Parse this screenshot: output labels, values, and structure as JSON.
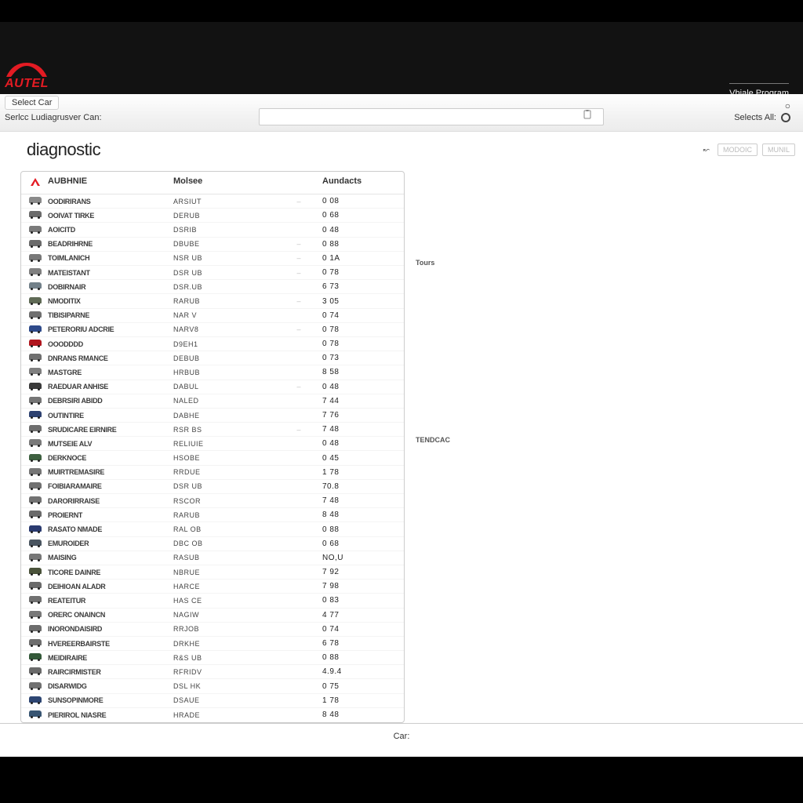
{
  "brand": {
    "name": "AUTEL"
  },
  "header": {
    "program_link": "Vhiale Program"
  },
  "filters": {
    "select_car": "Select Car",
    "serial_label": "Serlcc Ludiagrusver Can:",
    "search_placeholder": "",
    "select_all": "Selects All:"
  },
  "page": {
    "title": "diagnostic"
  },
  "action_buttons": {
    "a": "MODOIC",
    "b": "MUNIL"
  },
  "side_labels": {
    "tours": "Tours",
    "tender": "TENDCAC"
  },
  "table": {
    "head_brand": "AUBHNIE",
    "head_model": "Molsee",
    "head_amount": "Aundacts",
    "brand_icon_color": "#e31b23",
    "rows": [
      {
        "color": "#8a8a8a",
        "name": "OODIRIRANS",
        "model": "ARSIUT",
        "mid": "–",
        "amount": "0 08"
      },
      {
        "color": "#6b6b6b",
        "name": "OOIVAT TIRKE",
        "model": "DERUB",
        "mid": "",
        "amount": "0 68"
      },
      {
        "color": "#7a7a7a",
        "name": "AOICITD",
        "model": "DSRIB",
        "mid": "",
        "amount": "0 48"
      },
      {
        "color": "#6a6a6a",
        "name": "BEADRIHRNE",
        "model": "DBUBE",
        "mid": "–",
        "amount": "0 88"
      },
      {
        "color": "#787878",
        "name": "TOIMLANICH",
        "model": "NSR UB",
        "mid": "–",
        "amount": "0 1A"
      },
      {
        "color": "#808080",
        "name": "MATEISTANT",
        "model": "DSR UB",
        "mid": "–",
        "amount": "0 78"
      },
      {
        "color": "#728089",
        "name": "DOBIRNAIR",
        "model": "DSR.UB",
        "mid": "",
        "amount": "6 73"
      },
      {
        "color": "#5f6a55",
        "name": "NMODITIX",
        "model": "RARUB",
        "mid": "–",
        "amount": "3 05"
      },
      {
        "color": "#707070",
        "name": "TIBISIPARNE",
        "model": "NAR V",
        "mid": "",
        "amount": "0 74"
      },
      {
        "color": "#2e4a8a",
        "name": "PETERORIU ADCRIE",
        "model": "NARV8",
        "mid": "–",
        "amount": "0 78"
      },
      {
        "color": "#b0161e",
        "name": "OOODDDD",
        "model": "D9EH1",
        "mid": "",
        "amount": "0 78"
      },
      {
        "color": "#6e6e6e",
        "name": "DNRANS RMANCE",
        "model": "DEBUB",
        "mid": "",
        "amount": "0 73"
      },
      {
        "color": "#7f7f7f",
        "name": "MASTGRE",
        "model": "HRBUB",
        "mid": "",
        "amount": "8 58"
      },
      {
        "color": "#3a3a3a",
        "name": "RAEDUAR ANHISE",
        "model": "DABUL",
        "mid": "–",
        "amount": "0 48"
      },
      {
        "color": "#757575",
        "name": "DEBRSIRI ABIDD",
        "model": "NALED",
        "mid": "",
        "amount": "7 44"
      },
      {
        "color": "#2d4170",
        "name": "OUTINTIRE",
        "model": "DABHE",
        "mid": "",
        "amount": "7 76"
      },
      {
        "color": "#6e6e6e",
        "name": "SRUDICARE EIRNIRE",
        "model": "RSR BS",
        "mid": "–",
        "amount": "7 48"
      },
      {
        "color": "#7a7a7a",
        "name": "MUTSEIE ALV",
        "model": "RELIUIE",
        "mid": "",
        "amount": "0 48"
      },
      {
        "color": "#3e6040",
        "name": "DERKNOCE",
        "model": "HSOBE",
        "mid": "",
        "amount": "0 45"
      },
      {
        "color": "#767676",
        "name": "MUIRTREMASIRE",
        "model": "RRDUE",
        "mid": "",
        "amount": "1 78"
      },
      {
        "color": "#707070",
        "name": "FOIBIARAMAIRE",
        "model": "DSR UB",
        "mid": "",
        "amount": "70.8"
      },
      {
        "color": "#727272",
        "name": "DARORIRRAISE",
        "model": "RSCOR",
        "mid": "",
        "amount": "7 48"
      },
      {
        "color": "#6a6a6a",
        "name": "PROIERNT",
        "model": "RARUB",
        "mid": "",
        "amount": "8 48"
      },
      {
        "color": "#2a3a6f",
        "name": "RASATO NMADE",
        "model": "RAL OB",
        "mid": "",
        "amount": "0 88"
      },
      {
        "color": "#4a5560",
        "name": "EMUROIDER",
        "model": "DBC OB",
        "mid": "",
        "amount": "0 68"
      },
      {
        "color": "#767676",
        "name": "MAISING",
        "model": "RASUB",
        "mid": "",
        "amount": "NO,U"
      },
      {
        "color": "#4a523a",
        "name": "TICORE DAINRE",
        "model": "NBRUE",
        "mid": "",
        "amount": "7 92"
      },
      {
        "color": "#6a6a6a",
        "name": "DEIHIOAN ALADR",
        "model": "HARCE",
        "mid": "",
        "amount": "7 98"
      },
      {
        "color": "#707070",
        "name": "REATEITUR",
        "model": "HAS CE",
        "mid": "",
        "amount": "0 83"
      },
      {
        "color": "#787878",
        "name": "ORERC ONAINCN",
        "model": "NAGIW",
        "mid": "",
        "amount": "4 77"
      },
      {
        "color": "#6c6c6c",
        "name": "INORONDAISIRD",
        "model": "RRJOB",
        "mid": "",
        "amount": "0 74"
      },
      {
        "color": "#6e6e6e",
        "name": "HVEREERBAIRSTE",
        "model": "DRKHE",
        "mid": "",
        "amount": "6 78"
      },
      {
        "color": "#335838",
        "name": "MEIDIRAIRE",
        "model": "R&S UB",
        "mid": "",
        "amount": "0 88"
      },
      {
        "color": "#6a6a6a",
        "name": "RAIRCIRMISTER",
        "model": "RFRIDV",
        "mid": "",
        "amount": "4.9.4"
      },
      {
        "color": "#707070",
        "name": "DISARWIDG",
        "model": "DSL HK",
        "mid": "",
        "amount": "0 75"
      },
      {
        "color": "#2d4572",
        "name": "SUNSOPINMORE",
        "model": "DSAUE",
        "mid": "",
        "amount": "1 78"
      },
      {
        "color": "#385572",
        "name": "PIERIROL NIASRE",
        "model": "HRADE",
        "mid": "",
        "amount": "8 48"
      }
    ]
  },
  "footer": {
    "label": "Car:"
  }
}
